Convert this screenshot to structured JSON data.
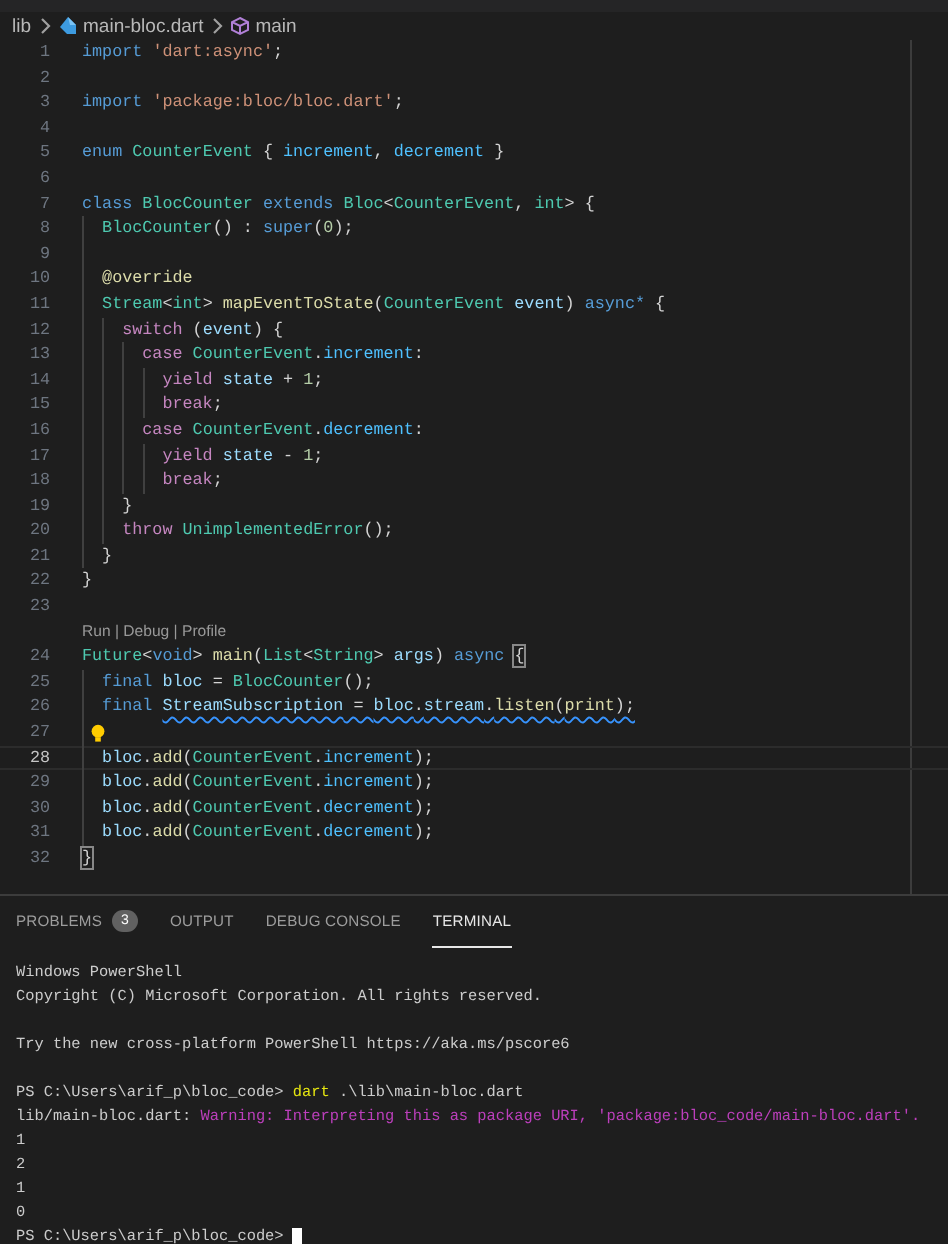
{
  "breadcrumb": {
    "folder": "lib",
    "file": "main-bloc.dart",
    "symbol": "main"
  },
  "editor": {
    "lines": [
      {
        "n": "1",
        "current": false,
        "tokens": [
          {
            "text": "import ",
            "kind": "keyword"
          },
          {
            "text": "'dart:async'",
            "kind": "string"
          },
          {
            "text": ";",
            "kind": "plain"
          }
        ]
      },
      {
        "n": "2",
        "current": false
      },
      {
        "n": "3",
        "current": false,
        "tokens": [
          {
            "text": "import ",
            "kind": "keyword"
          },
          {
            "text": "'package:bloc/bloc.dart'",
            "kind": "string"
          },
          {
            "text": ";",
            "kind": "plain"
          }
        ]
      },
      {
        "n": "4",
        "current": false
      },
      {
        "n": "5",
        "current": false,
        "tokens": [
          {
            "text": "enum ",
            "kind": "keyword"
          },
          {
            "text": "CounterEvent",
            "kind": "type"
          },
          {
            "text": " { ",
            "kind": "plain"
          },
          {
            "text": "increment",
            "kind": "member"
          },
          {
            "text": ", ",
            "kind": "plain"
          },
          {
            "text": "decrement",
            "kind": "member"
          },
          {
            "text": " }",
            "kind": "plain"
          }
        ]
      },
      {
        "n": "6",
        "current": false
      },
      {
        "n": "7",
        "current": false,
        "tokens": [
          {
            "text": "class ",
            "kind": "keyword"
          },
          {
            "text": "BlocCounter",
            "kind": "type"
          },
          {
            "text": " extends ",
            "kind": "keyword"
          },
          {
            "text": "Bloc",
            "kind": "type"
          },
          {
            "text": "<",
            "kind": "plain"
          },
          {
            "text": "CounterEvent",
            "kind": "type"
          },
          {
            "text": ", ",
            "kind": "plain"
          },
          {
            "text": "int",
            "kind": "type"
          },
          {
            "text": "> {",
            "kind": "plain"
          }
        ]
      },
      {
        "n": "8",
        "current": false,
        "tokens": [
          {
            "text": "  BlocCounter",
            "kind": "type"
          },
          {
            "text": "() : ",
            "kind": "plain"
          },
          {
            "text": "super",
            "kind": "keyword"
          },
          {
            "text": "(",
            "kind": "plain"
          },
          {
            "text": "0",
            "kind": "number"
          },
          {
            "text": ");",
            "kind": "plain"
          }
        ]
      },
      {
        "n": "9",
        "current": false
      },
      {
        "n": "10",
        "current": false,
        "tokens": [
          {
            "text": "  @override",
            "kind": "function"
          }
        ]
      },
      {
        "n": "11",
        "current": false,
        "tokens": [
          {
            "text": "  Stream",
            "kind": "type"
          },
          {
            "text": "<",
            "kind": "plain"
          },
          {
            "text": "int",
            "kind": "type"
          },
          {
            "text": "> ",
            "kind": "plain"
          },
          {
            "text": "mapEventToState",
            "kind": "function"
          },
          {
            "text": "(",
            "kind": "plain"
          },
          {
            "text": "CounterEvent ",
            "kind": "type"
          },
          {
            "text": "event",
            "kind": "variable"
          },
          {
            "text": ") ",
            "kind": "plain"
          },
          {
            "text": "async*",
            "kind": "keyword"
          },
          {
            "text": " {",
            "kind": "plain"
          }
        ]
      },
      {
        "n": "12",
        "current": false,
        "tokens": [
          {
            "text": "    switch",
            "kind": "control"
          },
          {
            "text": " (",
            "kind": "plain"
          },
          {
            "text": "event",
            "kind": "variable"
          },
          {
            "text": ") {",
            "kind": "plain"
          }
        ]
      },
      {
        "n": "13",
        "current": false,
        "tokens": [
          {
            "text": "      case ",
            "kind": "control"
          },
          {
            "text": "CounterEvent",
            "kind": "type"
          },
          {
            "text": ".",
            "kind": "plain"
          },
          {
            "text": "increment",
            "kind": "member"
          },
          {
            "text": ":",
            "kind": "plain"
          }
        ]
      },
      {
        "n": "14",
        "current": false,
        "tokens": [
          {
            "text": "        yield ",
            "kind": "control"
          },
          {
            "text": "state",
            "kind": "variable"
          },
          {
            "text": " + ",
            "kind": "plain"
          },
          {
            "text": "1",
            "kind": "number"
          },
          {
            "text": ";",
            "kind": "plain"
          }
        ]
      },
      {
        "n": "15",
        "current": false,
        "tokens": [
          {
            "text": "        break",
            "kind": "control"
          },
          {
            "text": ";",
            "kind": "plain"
          }
        ]
      },
      {
        "n": "16",
        "current": false,
        "tokens": [
          {
            "text": "      case ",
            "kind": "control"
          },
          {
            "text": "CounterEvent",
            "kind": "type"
          },
          {
            "text": ".",
            "kind": "plain"
          },
          {
            "text": "decrement",
            "kind": "member"
          },
          {
            "text": ":",
            "kind": "plain"
          }
        ]
      },
      {
        "n": "17",
        "current": false,
        "tokens": [
          {
            "text": "        yield ",
            "kind": "control"
          },
          {
            "text": "state",
            "kind": "variable"
          },
          {
            "text": " - ",
            "kind": "plain"
          },
          {
            "text": "1",
            "kind": "number"
          },
          {
            "text": ";",
            "kind": "plain"
          }
        ]
      },
      {
        "n": "18",
        "current": false,
        "tokens": [
          {
            "text": "        break",
            "kind": "control"
          },
          {
            "text": ";",
            "kind": "plain"
          }
        ]
      },
      {
        "n": "19",
        "current": false,
        "tokens": [
          {
            "text": "    }",
            "kind": "plain"
          }
        ]
      },
      {
        "n": "20",
        "current": false,
        "tokens": [
          {
            "text": "    throw ",
            "kind": "control"
          },
          {
            "text": "UnimplementedError",
            "kind": "type"
          },
          {
            "text": "();",
            "kind": "plain"
          }
        ]
      },
      {
        "n": "21",
        "current": false,
        "tokens": [
          {
            "text": "  }",
            "kind": "plain"
          }
        ]
      },
      {
        "n": "22",
        "current": false,
        "tokens": [
          {
            "text": "}",
            "kind": "plain"
          }
        ]
      },
      {
        "n": "23",
        "current": false
      },
      {
        "codelens": "Run | Debug | Profile",
        "n": "24",
        "current": false,
        "tokens": [
          {
            "text": "Future",
            "kind": "type"
          },
          {
            "text": "<",
            "kind": "plain"
          },
          {
            "text": "void",
            "kind": "keyword"
          },
          {
            "text": "> ",
            "kind": "plain"
          },
          {
            "text": "main",
            "kind": "function"
          },
          {
            "text": "(",
            "kind": "plain"
          },
          {
            "text": "List",
            "kind": "type"
          },
          {
            "text": "<",
            "kind": "plain"
          },
          {
            "text": "String",
            "kind": "type"
          },
          {
            "text": "> ",
            "kind": "plain"
          },
          {
            "text": "args",
            "kind": "variable"
          },
          {
            "text": ") ",
            "kind": "plain"
          },
          {
            "text": "async ",
            "kind": "keyword"
          },
          {
            "text": "{",
            "kind": "plain",
            "matched": true
          }
        ]
      },
      {
        "n": "25",
        "current": false,
        "tokens": [
          {
            "text": "  final ",
            "kind": "keyword"
          },
          {
            "text": "bloc",
            "kind": "variable"
          },
          {
            "text": " = ",
            "kind": "plain"
          },
          {
            "text": "BlocCounter",
            "kind": "type"
          },
          {
            "text": "();",
            "kind": "plain"
          }
        ]
      },
      {
        "n": "26",
        "current": false,
        "tokens": [
          {
            "text": "  final ",
            "kind": "keyword"
          },
          {
            "text": "StreamSubscription",
            "kind": "variable",
            "squiggle": true
          },
          {
            "text": " = ",
            "kind": "plain",
            "squiggle": true
          },
          {
            "text": "bloc",
            "kind": "variable",
            "squiggle": true
          },
          {
            "text": ".",
            "kind": "plain",
            "squiggle": true
          },
          {
            "text": "stream",
            "kind": "variable",
            "squiggle": true
          },
          {
            "text": ".",
            "kind": "plain",
            "squiggle": true
          },
          {
            "text": "listen",
            "kind": "function",
            "squiggle": true
          },
          {
            "text": "(",
            "kind": "plain",
            "squiggle": true
          },
          {
            "text": "print",
            "kind": "function",
            "squiggle": true
          },
          {
            "text": ");",
            "kind": "plain",
            "squiggle": true
          }
        ]
      },
      {
        "n": "27",
        "current": false,
        "lightbulb": true
      },
      {
        "n": "28",
        "current": true,
        "tokens": [
          {
            "text": "  bloc",
            "kind": "variable"
          },
          {
            "text": ".",
            "kind": "plain"
          },
          {
            "text": "add",
            "kind": "function"
          },
          {
            "text": "(",
            "kind": "plain"
          },
          {
            "text": "CounterEvent",
            "kind": "type"
          },
          {
            "text": ".",
            "kind": "plain"
          },
          {
            "text": "increment",
            "kind": "member"
          },
          {
            "text": ");",
            "kind": "plain"
          }
        ]
      },
      {
        "n": "29",
        "current": false,
        "tokens": [
          {
            "text": "  bloc",
            "kind": "variable"
          },
          {
            "text": ".",
            "kind": "plain"
          },
          {
            "text": "add",
            "kind": "function"
          },
          {
            "text": "(",
            "kind": "plain"
          },
          {
            "text": "CounterEvent",
            "kind": "type"
          },
          {
            "text": ".",
            "kind": "plain"
          },
          {
            "text": "increment",
            "kind": "member"
          },
          {
            "text": ");",
            "kind": "plain"
          }
        ]
      },
      {
        "n": "30",
        "current": false,
        "tokens": [
          {
            "text": "  bloc",
            "kind": "variable"
          },
          {
            "text": ".",
            "kind": "plain"
          },
          {
            "text": "add",
            "kind": "function"
          },
          {
            "text": "(",
            "kind": "plain"
          },
          {
            "text": "CounterEvent",
            "kind": "type"
          },
          {
            "text": ".",
            "kind": "plain"
          },
          {
            "text": "decrement",
            "kind": "member"
          },
          {
            "text": ");",
            "kind": "plain"
          }
        ]
      },
      {
        "n": "31",
        "current": false,
        "tokens": [
          {
            "text": "  bloc",
            "kind": "variable"
          },
          {
            "text": ".",
            "kind": "plain"
          },
          {
            "text": "add",
            "kind": "function"
          },
          {
            "text": "(",
            "kind": "plain"
          },
          {
            "text": "CounterEvent",
            "kind": "type"
          },
          {
            "text": ".",
            "kind": "plain"
          },
          {
            "text": "decrement",
            "kind": "member"
          },
          {
            "text": ");",
            "kind": "plain"
          }
        ]
      },
      {
        "n": "32",
        "current": false,
        "tokens": [
          {
            "text": "}",
            "kind": "plain",
            "matched": true
          }
        ]
      }
    ]
  },
  "panel": {
    "tabs": [
      {
        "label": "PROBLEMS",
        "badge": "3",
        "selected": false
      },
      {
        "label": "OUTPUT",
        "selected": false
      },
      {
        "label": "DEBUG CONSOLE",
        "selected": false
      },
      {
        "label": "TERMINAL",
        "selected": true
      }
    ],
    "terminal": [
      {
        "kind": "text",
        "segments": [
          {
            "text": "Windows PowerShell",
            "kind": "plain"
          }
        ]
      },
      {
        "kind": "text",
        "segments": [
          {
            "text": "Copyright (C) Microsoft Corporation. All rights reserved.",
            "kind": "plain"
          }
        ]
      },
      {
        "kind": "blank"
      },
      {
        "kind": "text",
        "segments": [
          {
            "text": "Try the new cross-platform PowerShell https://aka.ms/pscore6",
            "kind": "plain"
          }
        ]
      },
      {
        "kind": "blank"
      },
      {
        "kind": "text",
        "segments": [
          {
            "text": "PS C:\\Users\\arif_p\\bloc_code> ",
            "kind": "plain"
          },
          {
            "text": "dart",
            "kind": "command"
          },
          {
            "text": " .\\lib\\main-bloc.dart",
            "kind": "plain"
          }
        ]
      },
      {
        "kind": "text",
        "segments": [
          {
            "text": "lib/main-bloc.dart: ",
            "kind": "plain"
          },
          {
            "text": "Warning: Interpreting this as package URI, 'package:bloc_code/main-bloc.dart'.",
            "kind": "warning"
          }
        ]
      },
      {
        "kind": "text",
        "segments": [
          {
            "text": "1",
            "kind": "plain"
          }
        ]
      },
      {
        "kind": "text",
        "segments": [
          {
            "text": "2",
            "kind": "plain"
          }
        ]
      },
      {
        "kind": "text",
        "segments": [
          {
            "text": "1",
            "kind": "plain"
          }
        ]
      },
      {
        "kind": "text",
        "segments": [
          {
            "text": "0",
            "kind": "plain"
          }
        ]
      },
      {
        "kind": "text",
        "cursor": true,
        "segments": [
          {
            "text": "PS C:\\Users\\arif_p\\bloc_code> ",
            "kind": "plain"
          }
        ]
      }
    ]
  }
}
